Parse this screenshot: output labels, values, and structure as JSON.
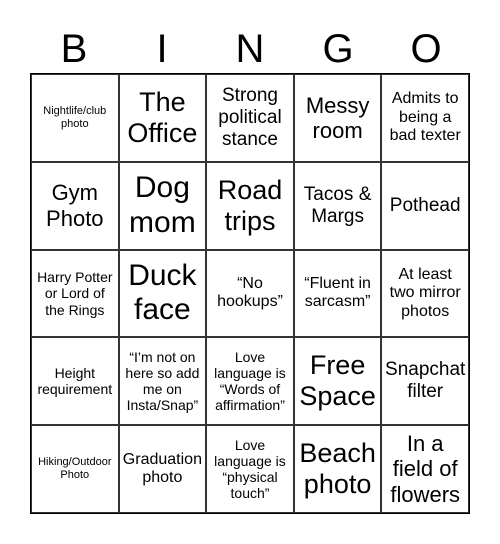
{
  "header": [
    "B",
    "I",
    "N",
    "G",
    "O"
  ],
  "cells": [
    [
      "Nightlife/club photo",
      "The Office",
      "Strong political stance",
      "Messy room",
      "Admits to being a bad texter"
    ],
    [
      "Gym Photo",
      "Dog mom",
      "Road trips",
      "Tacos & Margs",
      "Pothead"
    ],
    [
      "Harry Potter or Lord of the Rings",
      "Duck face",
      "“No hookups”",
      "“Fluent in sarcasm”",
      "At least two mirror photos"
    ],
    [
      "Height requirement",
      "“I’m not on here so add me on Insta/Snap”",
      "Love language is “Words of affirmation”",
      "Free Space",
      "Snapchat filter"
    ],
    [
      "Hiking/Outdoor Photo",
      "Graduation photo",
      "Love language is “physical touch”",
      "Beach photo",
      "In a field of flowers"
    ]
  ]
}
